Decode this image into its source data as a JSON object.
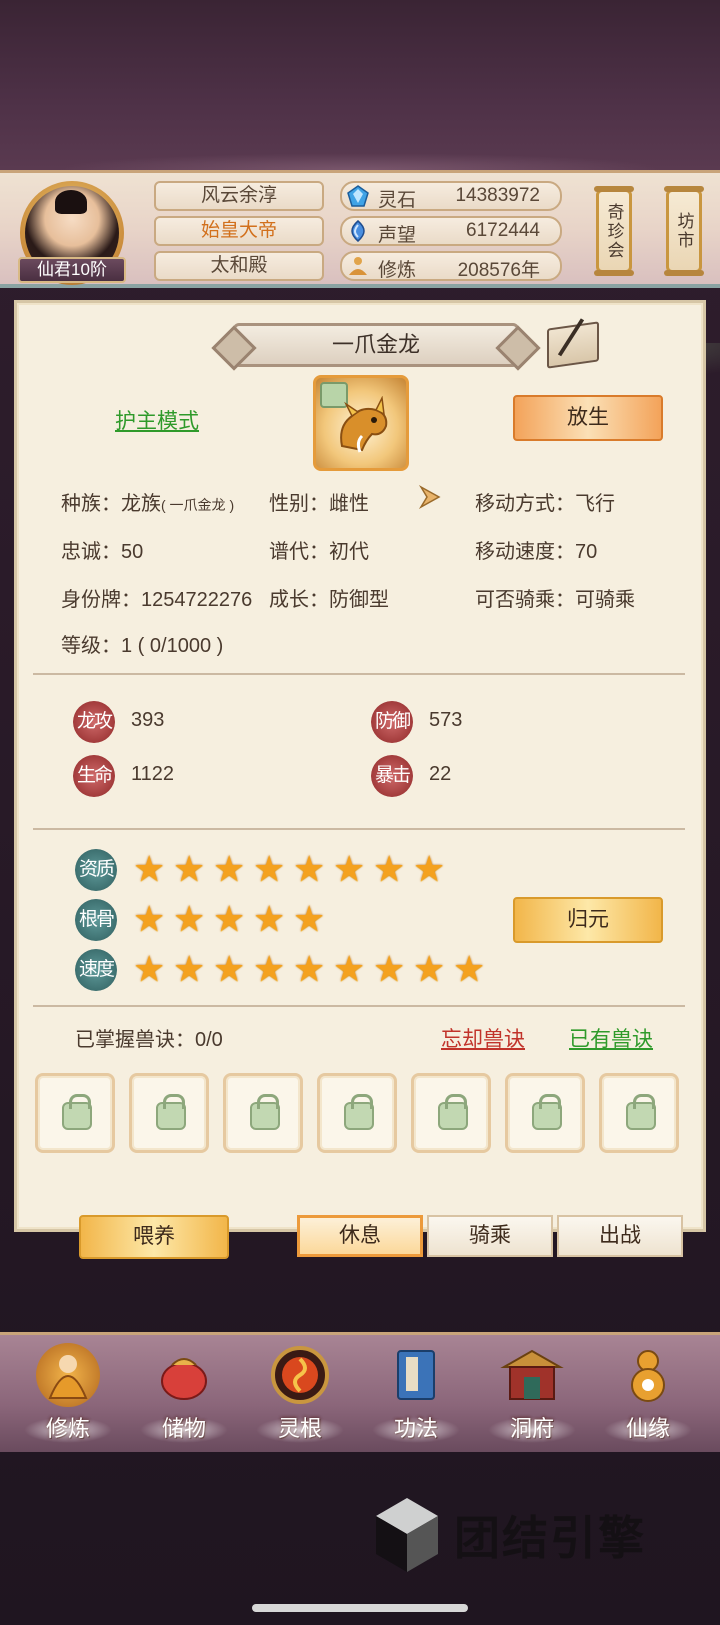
{
  "player": {
    "rank": "仙君10阶",
    "name": "风云余淳",
    "title": "始皇大帝",
    "location": "太和殿"
  },
  "resources": [
    {
      "icon": "spirit-stone-icon",
      "label": "灵石",
      "value": "14383972"
    },
    {
      "icon": "reputation-icon",
      "label": "声望",
      "value": "6172444"
    },
    {
      "icon": "cultivation-icon",
      "label": "修炼",
      "value": "208576年"
    }
  ],
  "side_buttons": {
    "treasure": "奇珍会",
    "market": "坊市"
  },
  "pet": {
    "name": "一爪金龙",
    "mode_link": "护主模式",
    "release_button": "放生",
    "info": {
      "race": "种族：龙族",
      "race_sub": "( 一爪金龙 )",
      "gender": "性别：雌性",
      "move_mode": "移动方式：飞行",
      "loyalty": "忠诚：50",
      "generation": "谱代：初代",
      "move_speed": "移动速度：70",
      "id_tag": "身份牌：1254722276",
      "growth": "成长：防御型",
      "rideable": "可否骑乘：可骑乘",
      "level": "等级：1 ( 0/1000 )"
    },
    "attributes": [
      {
        "badge": "龙攻",
        "value": "393"
      },
      {
        "badge": "防御",
        "value": "573"
      },
      {
        "badge": "生命",
        "value": "1122"
      },
      {
        "badge": "暴击",
        "value": "22"
      }
    ],
    "qualities": [
      {
        "badge": "资质",
        "stars": 8
      },
      {
        "badge": "根骨",
        "stars": 5
      },
      {
        "badge": "速度",
        "stars": 9
      }
    ],
    "reset_button": "归元",
    "skills_mastered": "已掌握兽诀：0/0",
    "forget_skill_link": "忘却兽诀",
    "owned_skill_link": "已有兽诀",
    "skill_slot_count": 7
  },
  "actions": {
    "feed": "喂养",
    "rest": "休息",
    "ride": "骑乘",
    "battle": "出战"
  },
  "nav": [
    {
      "label": "修炼",
      "icon": "monk-icon"
    },
    {
      "label": "储物",
      "icon": "bag-icon"
    },
    {
      "label": "灵根",
      "icon": "root-icon"
    },
    {
      "label": "功法",
      "icon": "book-icon"
    },
    {
      "label": "洞府",
      "icon": "palace-icon"
    },
    {
      "label": "仙缘",
      "icon": "gourd-icon"
    }
  ],
  "watermark": "团结引擎",
  "colors": {
    "accent_orange": "#f3a35a",
    "link_green": "#2f9a2a",
    "link_red": "#c1332a",
    "star": "#f4a11e"
  }
}
